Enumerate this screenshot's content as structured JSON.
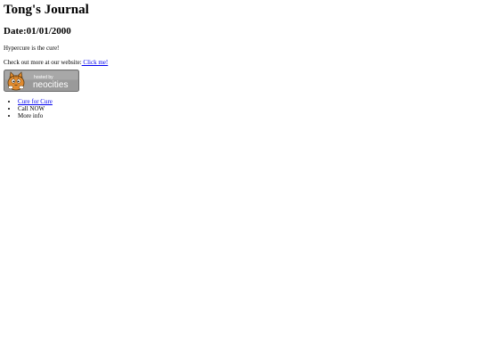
{
  "page": {
    "title": "Tong's Journal",
    "date": "Date:01/01/2000",
    "tagline": "Hypercure is the cure!",
    "website_prefix": "Check out more at our website:",
    "website_link": " Click me!"
  },
  "badge": {
    "line1": "hosted by",
    "line2": "neocities",
    "icon": "neocities-cat-icon",
    "colors": {
      "background": "#9a9a9a",
      "border": "#6e6e6e",
      "text": "#ffffff",
      "cat": "#e08a2e"
    }
  },
  "list": {
    "items": [
      {
        "label": "Cure for Cure",
        "link": true
      },
      {
        "label": "Call NOW",
        "link": false
      },
      {
        "label": "More info",
        "link": false
      }
    ]
  }
}
